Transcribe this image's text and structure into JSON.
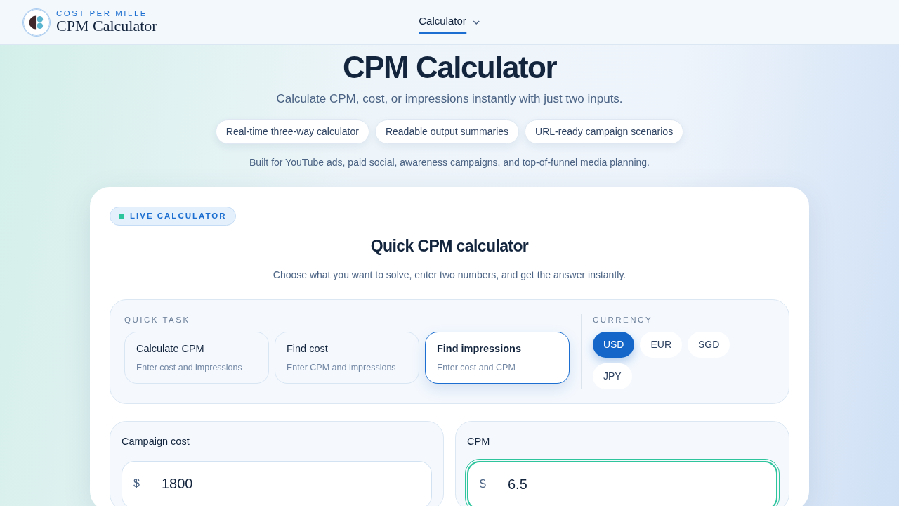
{
  "brand": {
    "eyebrow": "COST PER MILLE",
    "title": "CPM Calculator"
  },
  "nav": [
    {
      "label": "Calculator",
      "selected": true
    }
  ],
  "hero": {
    "title": "CPM Calculator",
    "subtitle": "Calculate CPM, cost, or impressions instantly with just two inputs.",
    "features": [
      "Real-time three-way calculator",
      "Readable output summaries",
      "URL-ready campaign scenarios"
    ],
    "note": "Built for YouTube ads, paid social, awareness campaigns, and top-of-funnel media planning."
  },
  "calculator": {
    "badge": "LIVE CALCULATOR",
    "title": "Quick CPM calculator",
    "subtitle": "Choose what you want to solve, enter two numbers, and get the answer instantly.",
    "task_label": "QUICK TASK",
    "tasks": [
      {
        "title": "Calculate CPM",
        "hint": "Enter cost and impressions",
        "selected": false
      },
      {
        "title": "Find cost",
        "hint": "Enter CPM and impressions",
        "selected": false
      },
      {
        "title": "Find impressions",
        "hint": "Enter cost and CPM",
        "selected": true
      }
    ],
    "currency_label": "CURRENCY",
    "currencies": [
      {
        "label": "USD",
        "selected": true
      },
      {
        "label": "EUR",
        "selected": false
      },
      {
        "label": "SGD",
        "selected": false
      },
      {
        "label": "JPY",
        "selected": false
      }
    ],
    "inputs": [
      {
        "label": "Campaign cost",
        "prefix": "$",
        "value": "1800",
        "focused": false
      },
      {
        "label": "CPM",
        "prefix": "$",
        "value": "6.5",
        "focused": true
      }
    ]
  }
}
